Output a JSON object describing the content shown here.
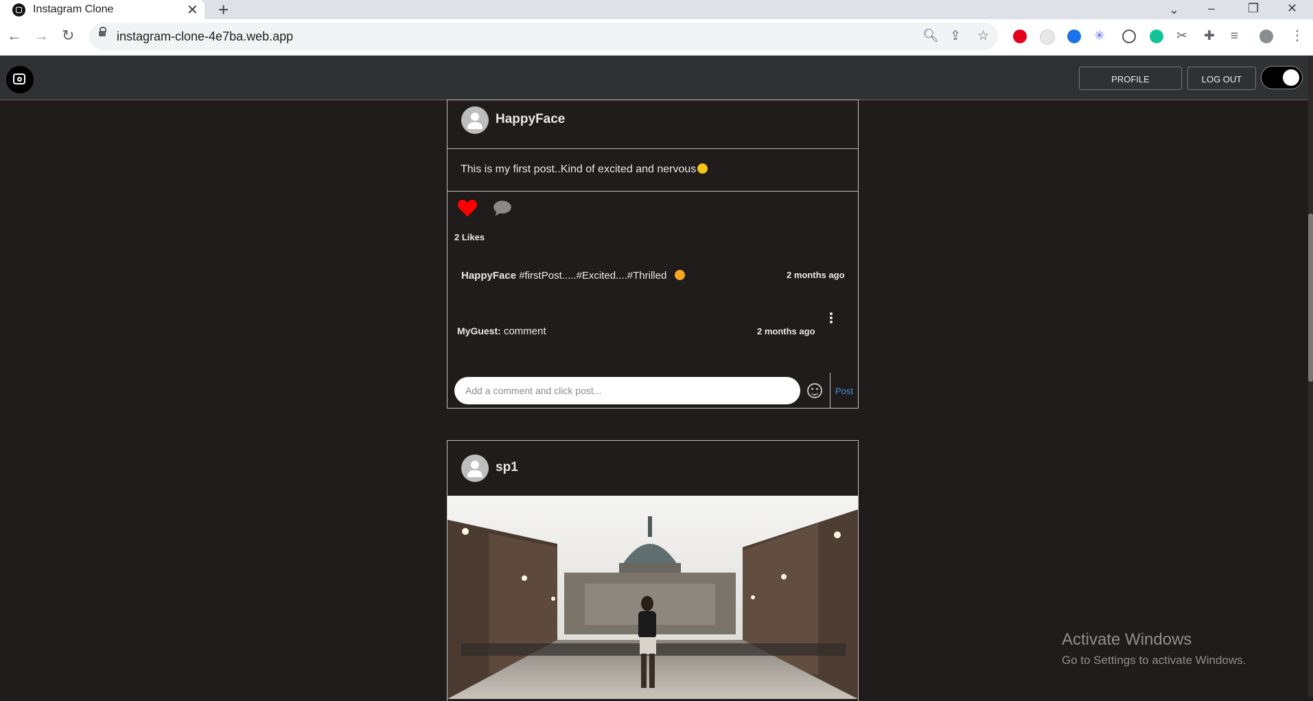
{
  "browser": {
    "tab_title": "Instagram Clone",
    "url": "instagram-clone-4e7ba.web.app"
  },
  "header": {
    "profile_label": "PROFILE",
    "logout_label": "LOG OUT",
    "dark_mode_on": true
  },
  "posts": [
    {
      "username": "HappyFace",
      "text": "This is my first post..Kind of excited and nervous",
      "likes": "2 Likes",
      "liked": true,
      "caption_user": "HappyFace",
      "caption_text": "#firstPost.....#Excited....#Thrilled",
      "caption_time": "2 months ago",
      "comments": [
        {
          "user": "MyGuest:",
          "text": "comment",
          "time": "2 months ago"
        }
      ],
      "comment_placeholder": "Add a comment and click post...",
      "post_label": "Post"
    },
    {
      "username": "sp1",
      "image_alt": "Street leading to a domed basilica at dusk with a woman walking"
    }
  ],
  "watermark": {
    "line1": "Activate Windows",
    "line2": "Go to Settings to activate Windows."
  },
  "colors": {
    "background": "#201c1b",
    "header": "#2f3133",
    "like_red": "#ff0000",
    "post_link": "#4a8fd8"
  }
}
